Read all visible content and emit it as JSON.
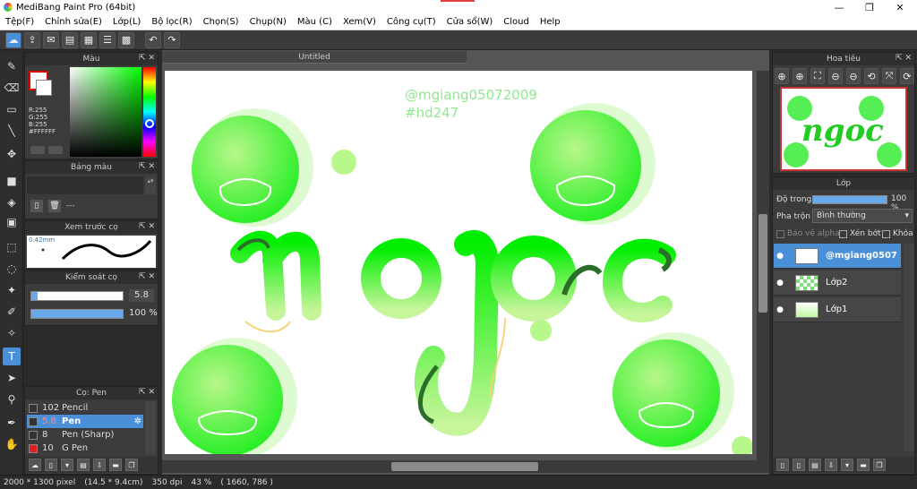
{
  "window": {
    "title": "MediBang Paint Pro (64bit)",
    "controls": [
      "—",
      "❐",
      "✕"
    ]
  },
  "menu": [
    "Tệp(F)",
    "Chỉnh sửa(E)",
    "Lớp(L)",
    "Bộ lọc(R)",
    "Chọn(S)",
    "Chụp(N)",
    "Màu (C)",
    "Xem(V)",
    "Công cụ(T)",
    "Cửa sổ(W)",
    "Cloud",
    "Help"
  ],
  "document": {
    "tab_title": "Untitled",
    "watermark_line1": "@mgiang05072009",
    "watermark_line2": "#hd247",
    "art_text": "ngoc"
  },
  "color_panel": {
    "title": "Màu",
    "r": "R:255",
    "g": "G:255",
    "b": "B:255",
    "hex": "#FFFFFF"
  },
  "palette_panel": {
    "title": "Bảng màu",
    "empty": "---"
  },
  "brush_preview_panel": {
    "title": "Xem trước cọ",
    "size": "0.42mm"
  },
  "brush_control_panel": {
    "title": "Kiểm soát cọ",
    "size_value": "5.8",
    "opacity_value": "100 %",
    "size_fraction": 0.07,
    "opacity_fraction": 1.0
  },
  "brush_list_panel": {
    "title": "Cọ: Pen",
    "items": [
      {
        "size": "102",
        "name": "Pencil",
        "color": "#333333"
      },
      {
        "size": "5.8",
        "name": "Pen",
        "color": "#333333"
      },
      {
        "size": "8",
        "name": "Pen (Sharp)",
        "color": "#333333"
      },
      {
        "size": "10",
        "name": "G Pen",
        "color": "#e02020"
      }
    ]
  },
  "navigator_panel": {
    "title": "Hoa tiêu",
    "thumb_text": "ngoc"
  },
  "layer_panel": {
    "title": "Lớp",
    "opacity_label": "Độ trong",
    "opacity_value": "100 %",
    "opacity_fraction": 1.0,
    "blend_label": "Pha trộn",
    "blend_value": "Bình thường",
    "protect_alpha": "Bảo vệ alpha",
    "clipping": "Xén bớt",
    "lock": "Khóa",
    "layers": [
      {
        "name": "@mgiang0507",
        "selected": true
      },
      {
        "name": "Lớp2",
        "selected": false
      },
      {
        "name": "Lớp1",
        "selected": false
      }
    ]
  },
  "status": {
    "size": "2000 * 1300 pixel",
    "physical": "(14.5 * 9.4cm)",
    "dpi": "350 dpi",
    "zoom": "43 %",
    "coords": "( 1660, 786 )"
  },
  "colors": {
    "accent": "#4a90d9",
    "bright_green": "#00ee00",
    "light_green": "#b8f78a",
    "dark_green": "#2a6e2a",
    "watermark": "#90e890"
  }
}
